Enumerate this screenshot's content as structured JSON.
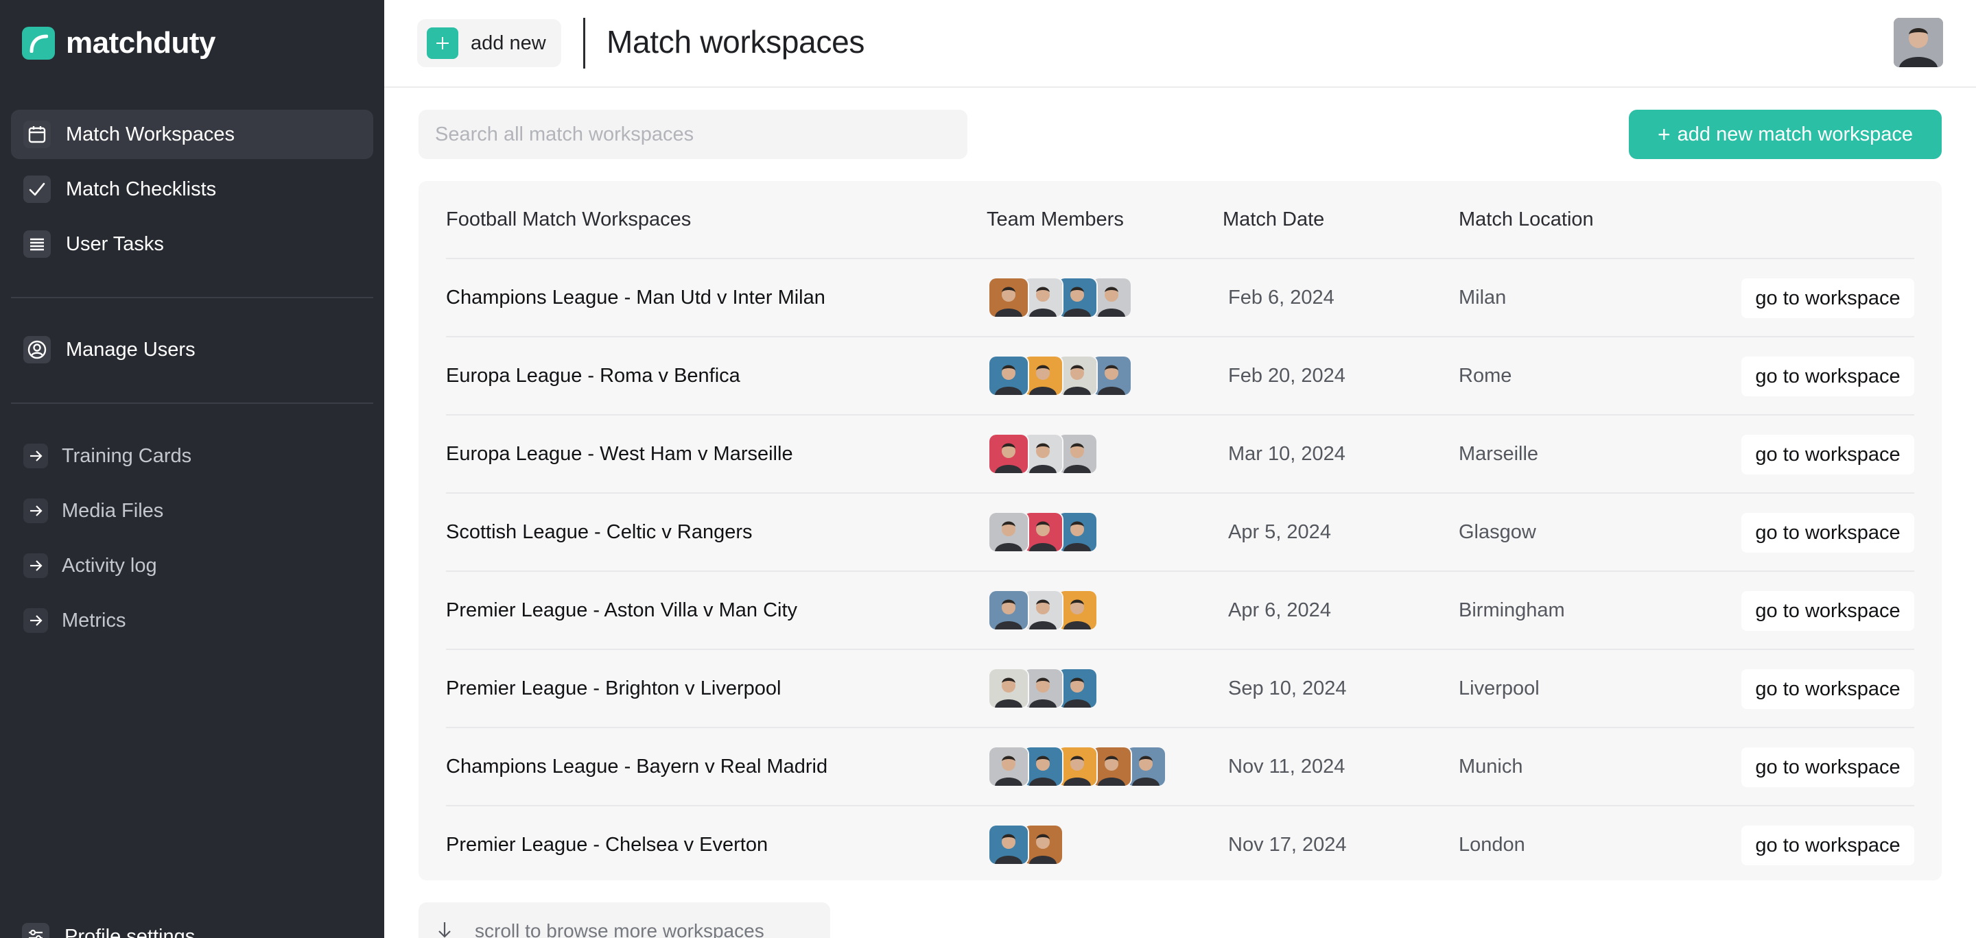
{
  "app": {
    "brand_name": "matchduty",
    "accent_color": "#2bbfa6"
  },
  "sidebar": {
    "primary": [
      {
        "label": "Match Workspaces",
        "icon": "calendar-icon",
        "active": true
      },
      {
        "label": "Match Checklists",
        "icon": "checkmark-icon"
      },
      {
        "label": "User Tasks",
        "icon": "list-icon"
      }
    ],
    "users": {
      "label": "Manage Users",
      "icon": "user-circle-icon"
    },
    "secondary": [
      {
        "label": "Training Cards",
        "icon": "arrow-right-icon"
      },
      {
        "label": "Media Files",
        "icon": "arrow-right-icon"
      },
      {
        "label": "Activity log",
        "icon": "arrow-right-icon"
      },
      {
        "label": "Metrics",
        "icon": "arrow-right-icon"
      }
    ],
    "profile": {
      "label": "Profile settings",
      "icon": "sliders-icon"
    }
  },
  "header": {
    "add_new_label": "add new",
    "page_title": "Match workspaces"
  },
  "toolbar": {
    "search_placeholder": "Search all match workspaces",
    "add_workspace_label": "add new match workspace"
  },
  "table": {
    "columns": [
      "Football Match Workspaces",
      "Team Members",
      "Match Date",
      "Match Location"
    ],
    "action_label": "go to workspace",
    "rows": [
      {
        "name": "Champions League - Man Utd v Inter Milan",
        "date": "Feb 6, 2024",
        "location": "Milan",
        "members": [
          "#b9733a",
          "#d9dadc",
          "#3f7fa7",
          "#c8cacd"
        ]
      },
      {
        "name": "Europa League - Roma v Benfica",
        "date": "Feb 20, 2024",
        "location": "Rome",
        "members": [
          "#3f7fa7",
          "#e9a13b",
          "#d8d8d2",
          "#6c8fb0"
        ]
      },
      {
        "name": "Europa League - West Ham v Marseille",
        "date": "Mar 10, 2024",
        "location": "Marseille",
        "members": [
          "#d8445a",
          "#d9dadc",
          "#c0c2c5"
        ]
      },
      {
        "name": "Scottish League - Celtic v Rangers",
        "date": "Apr 5, 2024",
        "location": "Glasgow",
        "members": [
          "#c0c2c5",
          "#d8445a",
          "#3f7fa7"
        ]
      },
      {
        "name": "Premier League - Aston Villa v Man City",
        "date": "Apr 6, 2024",
        "location": "Birmingham",
        "members": [
          "#6c8fb0",
          "#d9dadc",
          "#e9a13b"
        ]
      },
      {
        "name": "Premier League - Brighton v Liverpool",
        "date": "Sep 10, 2024",
        "location": "Liverpool",
        "members": [
          "#d8d8d2",
          "#c0c2c5",
          "#3f7fa7"
        ]
      },
      {
        "name": "Champions League - Bayern v Real Madrid",
        "date": "Nov 11, 2024",
        "location": "Munich",
        "members": [
          "#c0c2c5",
          "#3f7fa7",
          "#e9a13b",
          "#b9733a",
          "#6c8fb0"
        ]
      },
      {
        "name": "Premier League - Chelsea v Everton",
        "date": "Nov 17, 2024",
        "location": "London",
        "members": [
          "#3f7fa7",
          "#b9733a"
        ]
      }
    ]
  },
  "footer": {
    "scroll_hint": "scroll to browse more workspaces"
  }
}
